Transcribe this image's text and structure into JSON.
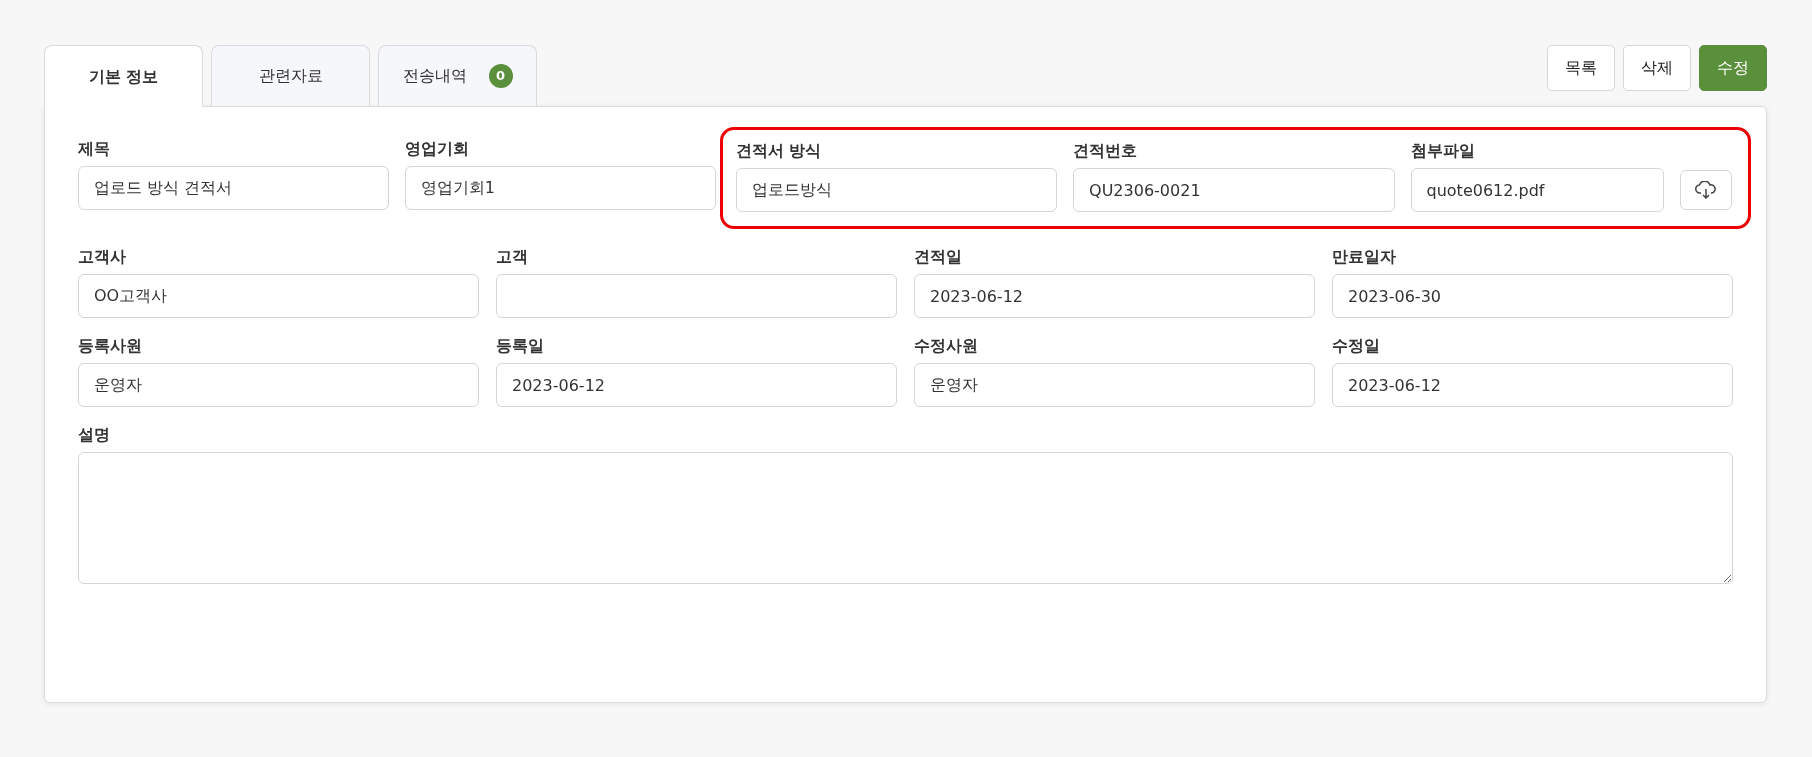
{
  "tabs": [
    {
      "label": "기본 정보",
      "selected": true
    },
    {
      "label": "관련자료",
      "selected": false
    },
    {
      "label": "전송내역",
      "selected": false,
      "count": "0"
    }
  ],
  "actions": [
    {
      "label": "목록",
      "kind": "outline"
    },
    {
      "label": "삭제",
      "kind": "outline"
    },
    {
      "label": "수정",
      "kind": "primary"
    }
  ],
  "top_row": [
    {
      "fields": [
        {
          "label": "제목",
          "kind": "text",
          "value": "업로드 방식 견적서"
        },
        {
          "label": "영업기회",
          "kind": "text",
          "value": "영업기회1"
        }
      ]
    },
    {
      "highlighted": true,
      "fields": [
        {
          "label": "견적서 방식",
          "kind": "text",
          "value": "업로드방식"
        },
        {
          "label": "견적번호",
          "kind": "text",
          "value": "QU2306-0021"
        },
        {
          "label": "첨부파일",
          "kind": "file",
          "value": "quote0612.pdf"
        }
      ]
    }
  ],
  "rows": [
    [
      {
        "label": "고객사",
        "value": "OO고객사"
      },
      {
        "label": "고객"
      },
      {
        "label": "견적일",
        "value": "2023-06-12"
      },
      {
        "label": "만료일자",
        "value": "2023-06-30"
      }
    ],
    [
      {
        "label": "등록사원",
        "value": "운영자"
      },
      {
        "label": "등록일",
        "value": "2023-06-12"
      },
      {
        "label": "수정사원",
        "value": "운영자"
      },
      {
        "label": "수정일",
        "value": "2023-06-12"
      }
    ]
  ],
  "description": {
    "label": "설명"
  }
}
